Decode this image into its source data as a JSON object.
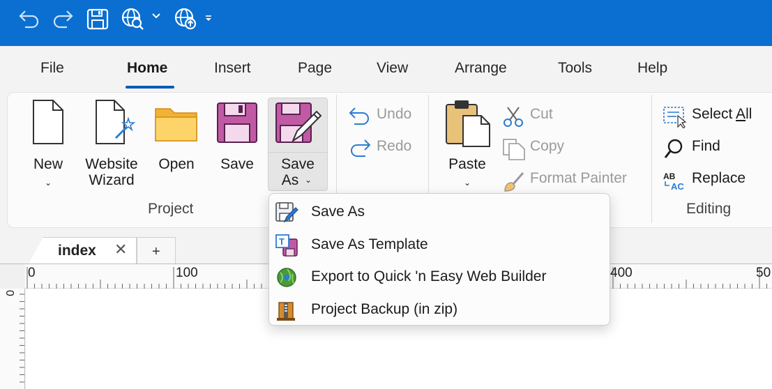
{
  "quick_access": {
    "icons": [
      "undo-icon",
      "redo-icon",
      "save-icon",
      "preview-web-icon",
      "dropdown-chevron-icon",
      "publish-web-icon",
      "customize-qat-icon"
    ],
    "title_bar_color": "#0a6fd0"
  },
  "ribbon_tabs": [
    {
      "label": "File"
    },
    {
      "label": "Home",
      "active": true
    },
    {
      "label": "Insert"
    },
    {
      "label": "Page"
    },
    {
      "label": "View"
    },
    {
      "label": "Arrange"
    },
    {
      "label": "Tools"
    },
    {
      "label": "Help"
    }
  ],
  "project_group": {
    "label": "Project",
    "new": {
      "line1": "New",
      "chevron": "⌄"
    },
    "wizard": {
      "line1": "Website",
      "line2": "Wizard"
    },
    "open": {
      "line1": "Open"
    },
    "save": {
      "line1": "Save"
    },
    "save_as": {
      "line1": "Save",
      "line2": "As",
      "chevron": "⌄"
    }
  },
  "history_group": {
    "undo": "Undo",
    "redo": "Redo"
  },
  "clipboard_group": {
    "paste": "Paste",
    "paste_chevron": "⌄",
    "cut": "Cut",
    "copy": "Copy",
    "format_painter": "Format Painter"
  },
  "editing_group": {
    "label": "Editing",
    "select_all": "Select All",
    "find": "Find",
    "replace": "Replace"
  },
  "document_tabs": {
    "active": "index",
    "close": "✕",
    "new_tab": "+"
  },
  "ruler": {
    "labels": [
      "0",
      "100",
      "400",
      "50"
    ],
    "vertical_label": "0"
  },
  "save_as_menu": [
    {
      "label": "Save As",
      "icon": "save-as-icon"
    },
    {
      "label": "Save As Template",
      "icon": "save-as-template-icon"
    },
    {
      "label": "Export to Quick 'n Easy Web Builder",
      "icon": "export-builder-icon"
    },
    {
      "label": "Project Backup (in zip)",
      "icon": "zip-backup-icon"
    }
  ]
}
